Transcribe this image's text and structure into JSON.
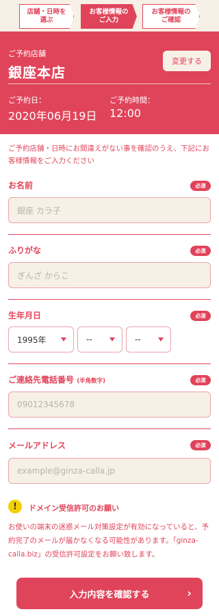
{
  "steps": [
    {
      "line1": "店舗・日時を",
      "line2": "選ぶ"
    },
    {
      "line1": "お客様情報の",
      "line2": "ご入力"
    },
    {
      "line1": "お客様情報の",
      "line2": "ご確認"
    }
  ],
  "store": {
    "label": "ご予約店舗",
    "name": "銀座本店",
    "change_label": "変更する",
    "date_label": "ご予約日：",
    "date_value": "2020年06月19日",
    "time_label": "ご予約時間：",
    "time_value": "12:00"
  },
  "notice": "ご予約店舗・日時にお間違えがない事を確認のうえ、下記にお客様情報をご入力ください",
  "form": {
    "required_badge": "必須",
    "name": {
      "label": "お名前",
      "placeholder": "銀座 カラ子"
    },
    "kana": {
      "label": "ふりがな",
      "placeholder": "ぎんざ からこ"
    },
    "birth": {
      "label": "生年月日",
      "year": "1995年",
      "month": "--",
      "day": "--"
    },
    "phone": {
      "label": "ご連絡先電話番号",
      "note": "(半角数字)",
      "placeholder": "09012345678"
    },
    "email": {
      "label": "メールアドレス",
      "placeholder": "example@ginza-calla.jp"
    }
  },
  "warning": {
    "icon": "exclamation-icon",
    "title": "ドメイン受信許可のお願い",
    "text": "お使いの端末の迷惑メール対策設定が有効になっていると、予約完了のメールが届かなくなる可能性があります。「ginza-calla.biz」の受信許可設定をお願い致します。"
  },
  "submit_label": "入力内容を確認する",
  "colors": {
    "accent": "#e0445a",
    "cream": "#f7f0e6"
  }
}
